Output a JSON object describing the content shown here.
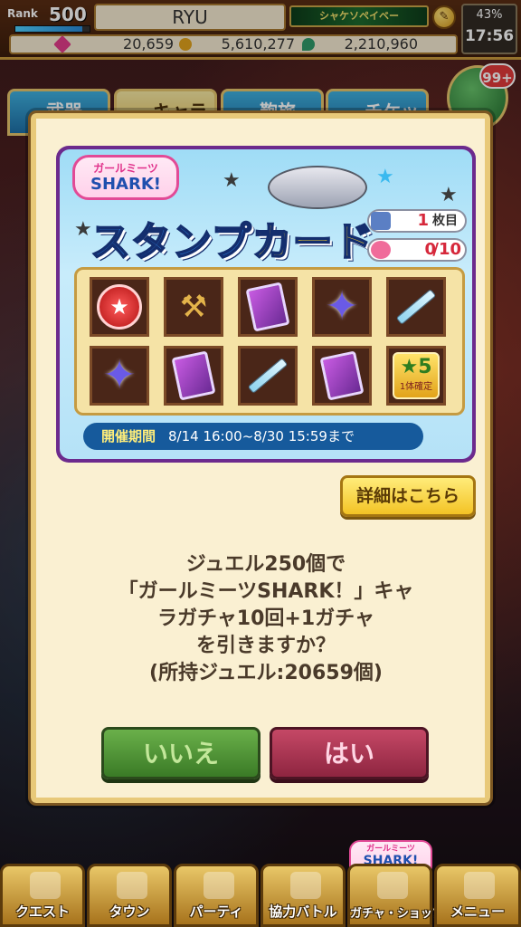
{
  "status": {
    "rank_label": "Rank",
    "rank_value": "500",
    "rank_progress": 0.9,
    "player_name": "RYU",
    "title_banner": "シャケソペイベー",
    "battery": "43%",
    "time": "17:56",
    "jewels": "20,659",
    "coins": "5,610,277",
    "drops": "2,210,960"
  },
  "behind_tabs": [
    "武器",
    "キャラ",
    "鞄旅",
    "チケット"
  ],
  "gift_badge": "99+",
  "banner": {
    "logo_top": "ガールミーツ",
    "logo_bottom": "SHARK!",
    "title_main": "スタンプ",
    "title_card": "カード",
    "sheet_count": "1",
    "sheet_unit": "枚目",
    "stamp_count": "0",
    "stamp_total": "/10",
    "period_label": "開催期間",
    "period_text": "8/14 16:00~8/30 15:59まで",
    "five_star_label": "5",
    "five_star_note": "1体確定"
  },
  "detail_button": "詳細はこちら",
  "message_lines": [
    "ジュエル250個で",
    "「ガールミーツSHARK！」キャ",
    "ラガチャ10回+1ガチャ",
    "を引きますか？",
    "(所持ジュエル:20659個)"
  ],
  "buttons": {
    "no": "いいえ",
    "yes": "はい"
  },
  "bottom_logo": {
    "top": "ガールミーツ",
    "bottom": "SHARK!"
  },
  "nav": [
    "クエスト",
    "タウン",
    "パーティ",
    "協力バトル",
    "ガチャ・ショップ",
    "メニュー"
  ],
  "colors": {
    "dialog_bg": "#faf0d2",
    "no_button": "#4f9538",
    "yes_button": "#a8304f"
  }
}
